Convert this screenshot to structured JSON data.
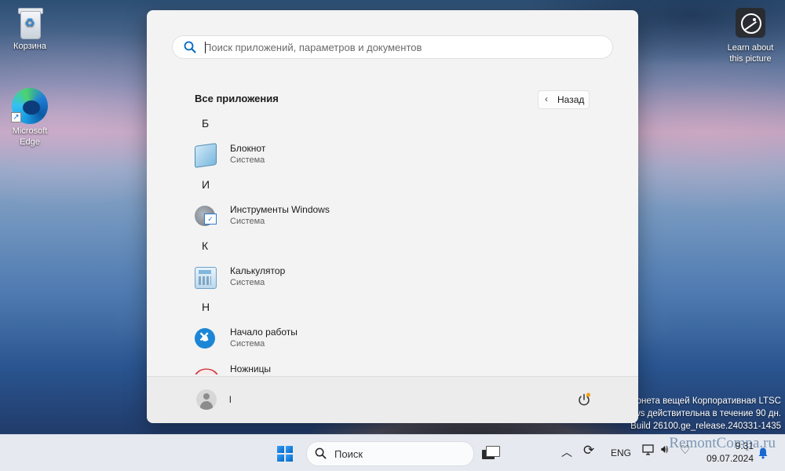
{
  "desktop": {
    "icons": [
      {
        "label": "Корзина",
        "icon": "recycle-bin-icon"
      },
      {
        "label": "Microsoft Edge",
        "label_lines": [
          "Microsoft",
          "Edge"
        ],
        "icon": "edge-icon"
      },
      {
        "label_lines": [
          "Learn about",
          "this picture"
        ],
        "icon": "learn-about-picture-icon"
      }
    ],
    "watermark_lines": [
      "онета вещей Корпоративная LTSC",
      "ws действительна в течение 90 дн.",
      "Build 26100.ge_release.240331-1435"
    ]
  },
  "start_menu": {
    "search": {
      "placeholder": "Поиск приложений, параметров и документов",
      "value": ""
    },
    "all_apps_title": "Все приложения",
    "back_label": "Назад",
    "sections": [
      {
        "letter": "Б",
        "apps": [
          {
            "name": "Блокнот",
            "sub": "Система",
            "icon": "notepad-icon"
          }
        ]
      },
      {
        "letter": "И",
        "apps": [
          {
            "name": "Инструменты Windows",
            "sub": "Система",
            "icon": "windows-tools-icon"
          }
        ]
      },
      {
        "letter": "К",
        "apps": [
          {
            "name": "Калькулятор",
            "sub": "Система",
            "icon": "calculator-icon"
          }
        ]
      },
      {
        "letter": "Н",
        "apps": [
          {
            "name": "Начало работы",
            "sub": "Система",
            "icon": "get-started-icon"
          },
          {
            "name": "Ножницы",
            "sub": "",
            "icon": "snipping-tool-icon"
          }
        ]
      }
    ],
    "user": {
      "name": "l"
    }
  },
  "taskbar": {
    "search_label": "Поиск",
    "language": "ENG",
    "time": "9:31",
    "date": "09.07.2024"
  },
  "site_watermark": "RemontCompa.ru",
  "colors": {
    "accent": "#0067c0",
    "menu_bg": "#f3f3f3",
    "taskbar_bg": "#e6eaf0"
  }
}
